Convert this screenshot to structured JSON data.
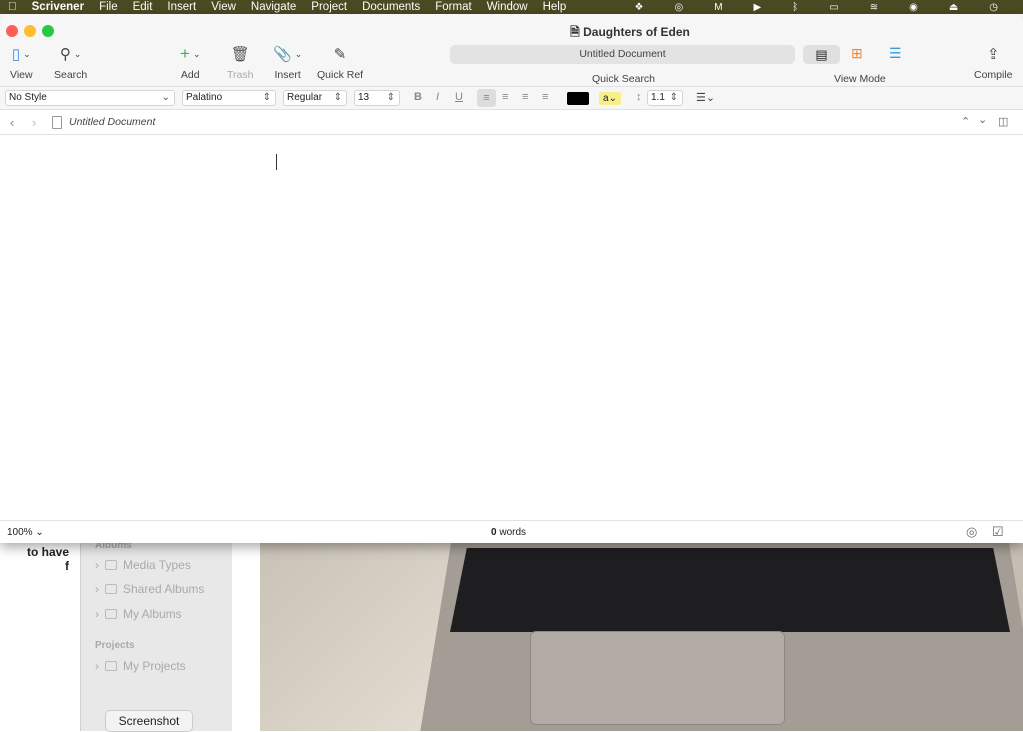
{
  "menubar": {
    "app": "Scrivener",
    "items": [
      "File",
      "Edit",
      "Insert",
      "View",
      "Navigate",
      "Project",
      "Documents",
      "Format",
      "Window",
      "Help"
    ]
  },
  "window": {
    "title": "Daughters of Eden"
  },
  "toolbar": {
    "view": "View",
    "search": "Search",
    "add": "Add",
    "trash": "Trash",
    "insert": "Insert",
    "quick_ref": "Quick Ref",
    "quick_search_value": "Untitled Document",
    "quick_search": "Quick Search",
    "view_mode": "View Mode",
    "compile": "Compile"
  },
  "format": {
    "style": "No Style",
    "font": "Palatino",
    "weight": "Regular",
    "size": "13",
    "bold": "B",
    "italic": "I",
    "underline": "U",
    "highlight": "a",
    "line_spacing": "1.1",
    "text_color": "#000000",
    "highlight_color": "#f7f08a"
  },
  "header": {
    "doc_title": "Untitled Document"
  },
  "footer": {
    "zoom": "100%",
    "word_count": "0",
    "words_label": "words"
  },
  "background": {
    "partial_text_1": "to have",
    "partial_text_2": "f",
    "albums_header": "Albums",
    "items": [
      "Media Types",
      "Shared Albums",
      "My Albums"
    ],
    "projects_header": "Projects",
    "projects": [
      "My Projects"
    ],
    "button": "Screenshot"
  }
}
